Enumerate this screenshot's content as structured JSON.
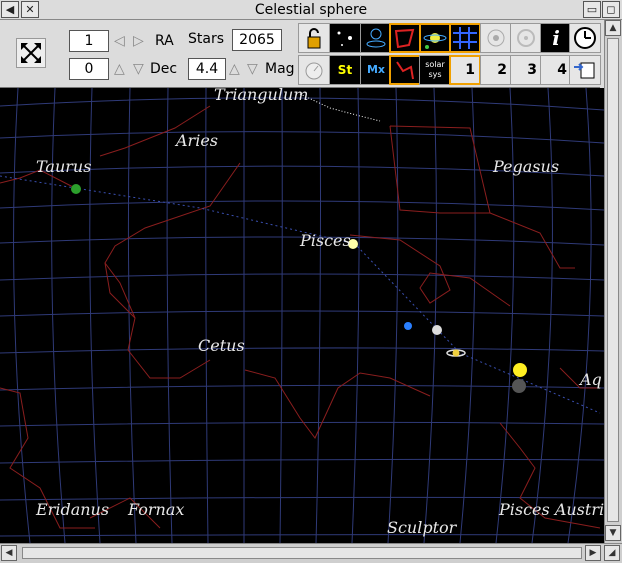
{
  "window": {
    "title": "Celestial sphere"
  },
  "controls": {
    "ra_value": "1",
    "ra_label": "RA",
    "dec_value": "0",
    "dec_label": "Dec",
    "stars_label": "Stars",
    "stars_value": "2065",
    "mag_value": "4.4",
    "mag_label": "Mag"
  },
  "toolbar": {
    "solar_sys_label": "solar sys",
    "st_label": "St",
    "mx_label": "Mx",
    "info_label": "i",
    "page1": "1",
    "page2": "2",
    "page3": "3",
    "page4": "4"
  },
  "constellations": [
    "Triangulum",
    "Aries",
    "Taurus",
    "Pegasus",
    "Pisces",
    "Cetus",
    "Aq",
    "Eridanus",
    "Fornax",
    "Sculptor",
    "Pisces Austrinus"
  ],
  "colors": {
    "sky": "#000000",
    "grid": "#2f3a78",
    "constellation_line": "#8a1e1e",
    "ecliptic": "#3a4fb0",
    "toolbar_bg": "#dcdcdc",
    "highlight": "#f0a000"
  }
}
